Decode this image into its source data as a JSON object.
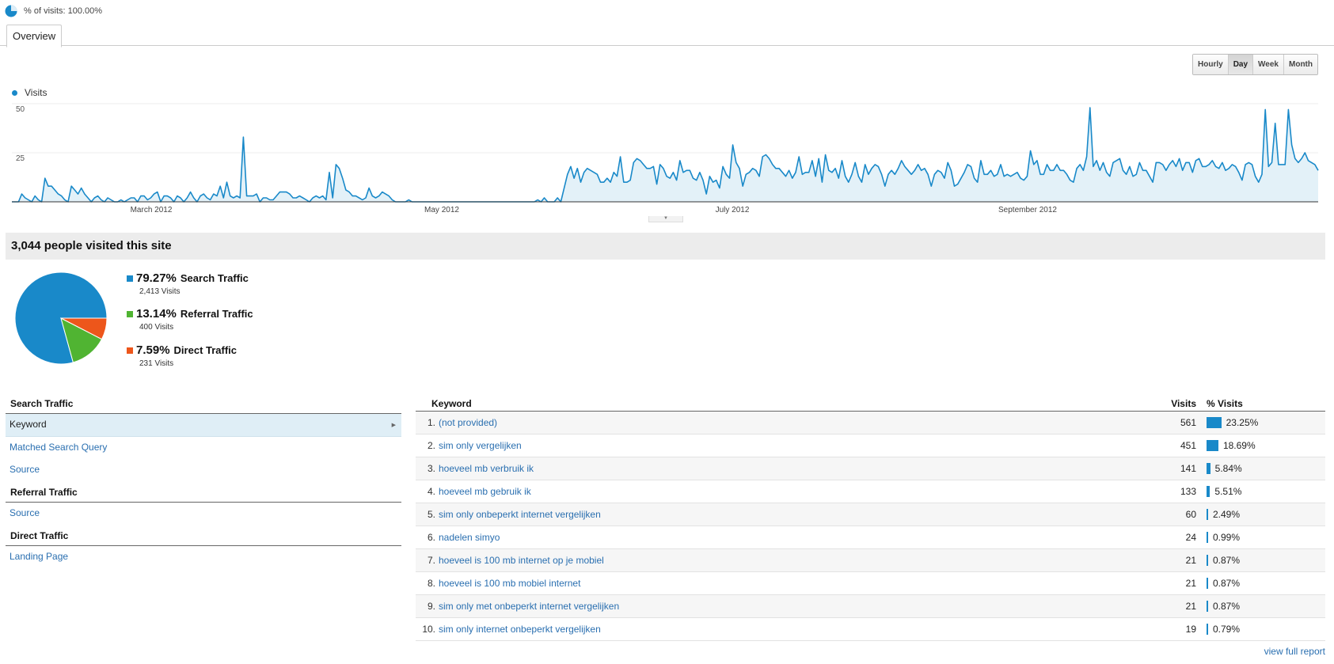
{
  "topbar": {
    "segment_label": "% of visits: 100.00%"
  },
  "tabs": [
    {
      "label": "Overview"
    }
  ],
  "granularity": [
    {
      "label": "Hourly",
      "active": false
    },
    {
      "label": "Day",
      "active": true
    },
    {
      "label": "Week",
      "active": false
    },
    {
      "label": "Month",
      "active": false
    }
  ],
  "colors": {
    "series": "#1989c9",
    "search": "#1989c9",
    "referral": "#50b432",
    "direct": "#ed561b"
  },
  "chart_data": [
    {
      "type": "area",
      "series": [
        {
          "name": "Visits"
        }
      ],
      "y_ticks": [
        "50",
        "25"
      ],
      "ylim": [
        0,
        50
      ],
      "x_ticks": [
        "March 2012",
        "May 2012",
        "July 2012",
        "September 2012"
      ],
      "grid": true,
      "legend": "top-left",
      "y": [
        0,
        0,
        0,
        4,
        2,
        1,
        0,
        3,
        1,
        0,
        12,
        8,
        8,
        6,
        4,
        3,
        1,
        0,
        8,
        6,
        4,
        7,
        4,
        2,
        0,
        2,
        3,
        1,
        0,
        2,
        1,
        0,
        0,
        1,
        0,
        1,
        2,
        2,
        0,
        3,
        3,
        1,
        2,
        4,
        5,
        0,
        3,
        3,
        2,
        0,
        3,
        2,
        0,
        2,
        5,
        2,
        0,
        3,
        4,
        2,
        1,
        4,
        3,
        8,
        2,
        10,
        3,
        2,
        3,
        2,
        33,
        3,
        3,
        3,
        4,
        0,
        2,
        2,
        1,
        1,
        3,
        5,
        5,
        5,
        4,
        2,
        2,
        3,
        2,
        1,
        0,
        2,
        3,
        2,
        3,
        1,
        15,
        2,
        19,
        17,
        12,
        6,
        5,
        3,
        3,
        2,
        1,
        2,
        7,
        3,
        2,
        3,
        5,
        4,
        3,
        1,
        0,
        0,
        0,
        0,
        1,
        0,
        0,
        0,
        0,
        0,
        0,
        0,
        0,
        0,
        0,
        0,
        0,
        0,
        0,
        0,
        0,
        0,
        0,
        0,
        0,
        0,
        0,
        0,
        0,
        0,
        0,
        0,
        0,
        0,
        0,
        0,
        0,
        0,
        0,
        0,
        0,
        0,
        0,
        1,
        0,
        2,
        0,
        0,
        0,
        2,
        0,
        7,
        14,
        18,
        12,
        17,
        10,
        15,
        17,
        16,
        15,
        14,
        10,
        10,
        12,
        10,
        15,
        13,
        23,
        10,
        10,
        11,
        20,
        22,
        21,
        19,
        17,
        17,
        18,
        9,
        19,
        17,
        13,
        12,
        15,
        11,
        21,
        15,
        16,
        16,
        12,
        11,
        15,
        11,
        4,
        13,
        10,
        11,
        7,
        18,
        14,
        12,
        29,
        20,
        17,
        8,
        14,
        15,
        17,
        16,
        13,
        23,
        24,
        22,
        19,
        17,
        17,
        15,
        13,
        16,
        12,
        15,
        23,
        14,
        15,
        15,
        21,
        13,
        22,
        10,
        24,
        16,
        15,
        17,
        12,
        21,
        13,
        10,
        14,
        20,
        13,
        10,
        19,
        14,
        17,
        19,
        18,
        14,
        8,
        14,
        16,
        14,
        17,
        21,
        18,
        16,
        14,
        16,
        19,
        16,
        17,
        14,
        8,
        14,
        16,
        15,
        12,
        20,
        16,
        8,
        9,
        12,
        15,
        19,
        18,
        12,
        10,
        21,
        14,
        14,
        16,
        13,
        14,
        19,
        13,
        14,
        13,
        14,
        15,
        12,
        11,
        13,
        26,
        19,
        21,
        14,
        14,
        19,
        16,
        16,
        19,
        16,
        16,
        14,
        11,
        10,
        17,
        19,
        16,
        23,
        48,
        18,
        21,
        16,
        20,
        15,
        13,
        20,
        21,
        22,
        16,
        14,
        18,
        13,
        14,
        20,
        16,
        16,
        13,
        10,
        20,
        20,
        19,
        16,
        19,
        21,
        18,
        22,
        16,
        20,
        20,
        15,
        21,
        22,
        18,
        18,
        19,
        21,
        18,
        17,
        20,
        16,
        17,
        19,
        18,
        15,
        11,
        19,
        20,
        19,
        13,
        10,
        14,
        47,
        18,
        20,
        40,
        19,
        19,
        19,
        47,
        29,
        22,
        20,
        22,
        25,
        21,
        20,
        19,
        16
      ]
    },
    {
      "type": "pie",
      "title": "3,044 people visited this site",
      "slices": [
        {
          "name": "Search Traffic",
          "percent": "79.27%",
          "value": 79.27,
          "visits": "2,413 Visits"
        },
        {
          "name": "Referral Traffic",
          "percent": "13.14%",
          "value": 13.14,
          "visits": "400 Visits"
        },
        {
          "name": "Direct Traffic",
          "percent": "7.59%",
          "value": 7.59,
          "visits": "231 Visits"
        }
      ]
    }
  ],
  "nav": {
    "search_heading": "Search Traffic",
    "keyword": "Keyword",
    "matched": "Matched Search Query",
    "search_source": "Source",
    "referral_heading": "Referral Traffic",
    "referral_source": "Source",
    "direct_heading": "Direct Traffic",
    "landing": "Landing Page"
  },
  "table": {
    "headers": {
      "keyword": "Keyword",
      "visits": "Visits",
      "pct": "% Visits"
    },
    "rows": [
      {
        "idx": "1.",
        "keyword": "(not provided)",
        "visits": "561",
        "pct": "23.25%",
        "share": 23.25
      },
      {
        "idx": "2.",
        "keyword": "sim only vergelijken",
        "visits": "451",
        "pct": "18.69%",
        "share": 18.69
      },
      {
        "idx": "3.",
        "keyword": "hoeveel mb verbruik ik",
        "visits": "141",
        "pct": "5.84%",
        "share": 5.84
      },
      {
        "idx": "4.",
        "keyword": "hoeveel mb gebruik ik",
        "visits": "133",
        "pct": "5.51%",
        "share": 5.51
      },
      {
        "idx": "5.",
        "keyword": "sim only onbeperkt internet vergelijken",
        "visits": "60",
        "pct": "2.49%",
        "share": 2.49
      },
      {
        "idx": "6.",
        "keyword": "nadelen simyo",
        "visits": "24",
        "pct": "0.99%",
        "share": 0.99
      },
      {
        "idx": "7.",
        "keyword": "hoeveel is 100 mb internet op je mobiel",
        "visits": "21",
        "pct": "0.87%",
        "share": 0.87
      },
      {
        "idx": "8.",
        "keyword": "hoeveel is 100 mb mobiel internet",
        "visits": "21",
        "pct": "0.87%",
        "share": 0.87
      },
      {
        "idx": "9.",
        "keyword": "sim only met onbeperkt internet vergelijken",
        "visits": "21",
        "pct": "0.87%",
        "share": 0.87
      },
      {
        "idx": "10.",
        "keyword": "sim only internet onbeperkt vergelijken",
        "visits": "19",
        "pct": "0.79%",
        "share": 0.79
      }
    ],
    "view_full": "view full report"
  }
}
